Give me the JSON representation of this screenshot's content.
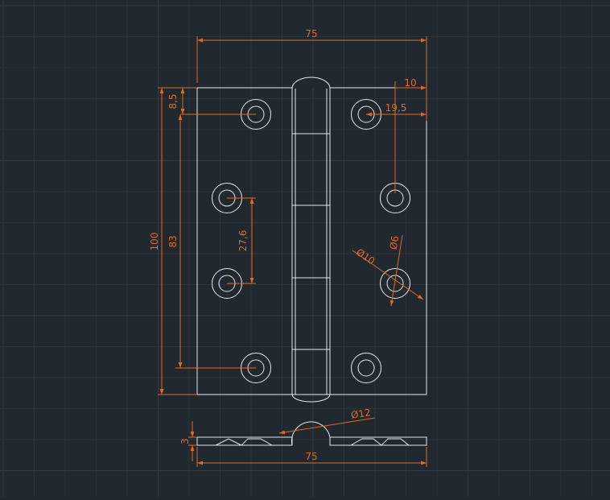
{
  "colors": {
    "background": "#212830",
    "grid_minor": "#2b323b",
    "grid_major": "#333b45",
    "geometry": "#e8e8e8",
    "dimension": "#e06a20"
  },
  "dimensions": {
    "overall_width_top": "75",
    "pin_inset": "10",
    "hole_offset": "19,5",
    "top_margin": "8,5",
    "overall_height": "100",
    "hole_span": "83",
    "hole_pitch": "27,6",
    "counterbore_dia": "Ø10",
    "hole_dia": "Ø6",
    "knuckle_dia": "Ø12",
    "thickness": "3",
    "overall_width_bottom": "75"
  }
}
